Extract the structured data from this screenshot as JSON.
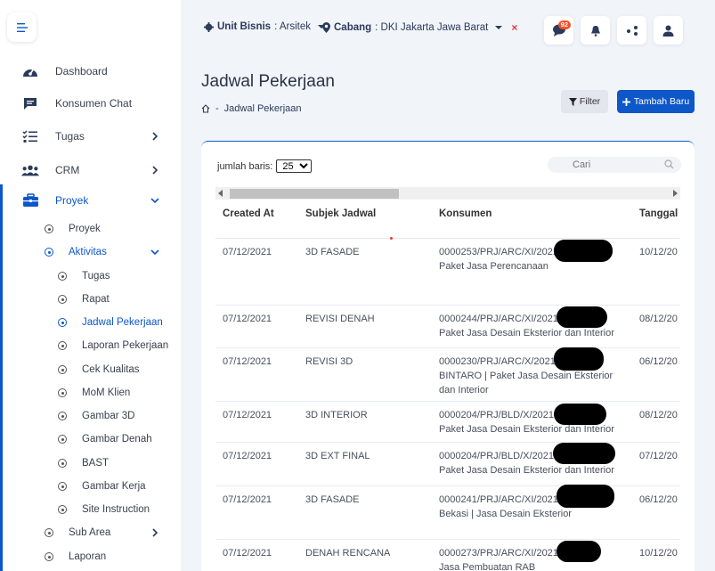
{
  "sidebar": {
    "nav": [
      {
        "label": "Dashboard",
        "icon": "dashboard-gauge-icon"
      },
      {
        "label": "Konsumen Chat",
        "icon": "chat-icon"
      },
      {
        "label": "Tugas",
        "icon": "checklist-icon"
      },
      {
        "label": "CRM",
        "icon": "users-icon"
      },
      {
        "label": "Proyek",
        "icon": "briefcase-icon"
      }
    ],
    "proyek_sub": [
      {
        "label": "Proyek"
      },
      {
        "label": "Aktivitas"
      }
    ],
    "aktivitas_sub": [
      {
        "label": "Tugas"
      },
      {
        "label": "Rapat"
      },
      {
        "label": "Jadwal Pekerjaan"
      },
      {
        "label": "Laporan Pekerjaan"
      },
      {
        "label": "Cek Kualitas"
      },
      {
        "label": "MoM Klien"
      },
      {
        "label": "Gambar 3D"
      },
      {
        "label": "Gambar Denah"
      },
      {
        "label": "BAST"
      },
      {
        "label": "Gambar Kerja"
      },
      {
        "label": "Site Instruction"
      }
    ],
    "bottom_sub": [
      {
        "label": "Sub Area"
      },
      {
        "label": "Laporan"
      }
    ]
  },
  "header": {
    "unit_label": "Unit Bisnis",
    "unit_value": ": Arsitek",
    "cabang_label": "Cabang",
    "cabang_value": ": DKI Jakarta Jawa Barat",
    "clear": "×",
    "notif_count": "92"
  },
  "page": {
    "title": "Jadwal Pekerjaan",
    "breadcrumb_sep": "-",
    "breadcrumb_current": "Jadwal Pekerjaan",
    "filter_label": "Filter",
    "add_label": "Tambah Baru"
  },
  "table": {
    "rows_label": "jumlah baris:",
    "rows_value": "25",
    "search_placeholder": "Cari",
    "columns": [
      "Created At",
      "Subjek Jadwal",
      "Konsumen",
      "Tanggal M"
    ],
    "rows": [
      {
        "created": "07/12/2021",
        "subject": "3D FASADE",
        "konsumen_1": "0000253/PRJ/ARC/XI/2021",
        "konsumen_2": "Paket Jasa Perencanaan",
        "tanggal": "10/12/20"
      },
      {
        "created": "07/12/2021",
        "subject": "REVISI DENAH",
        "konsumen_1": "0000244/PRJ/ARC/XI/2021",
        "konsumen_2": "Paket Jasa Desain Eksterior dan Interior",
        "tanggal": "08/12/20"
      },
      {
        "created": "07/12/2021",
        "subject": "REVISI 3D",
        "konsumen_1": "0000230/PRJ/ARC/X/2021",
        "konsumen_2": "BINTARO | Paket Jasa Desain Eksterior dan Interior",
        "tanggal": "06/12/20"
      },
      {
        "created": "07/12/2021",
        "subject": "3D INTERIOR",
        "konsumen_1": "0000204/PRJ/BLD/X/2021",
        "konsumen_2": "Paket Jasa Desain Eksterior dan Interior",
        "tanggal": "08/12/20"
      },
      {
        "created": "07/12/2021",
        "subject": "3D EXT FINAL",
        "konsumen_1": "0000204/PRJ/BLD/X/2021",
        "konsumen_2": "Paket Jasa Desain Eksterior dan Interior",
        "tanggal": "07/12/20"
      },
      {
        "created": "07/12/2021",
        "subject": "3D FASADE",
        "konsumen_1": "0000241/PRJ/ARC/XI/2021",
        "konsumen_2": "Bekasi | Jasa Desain Eksterior",
        "tanggal": "06/12/20"
      },
      {
        "created": "07/12/2021",
        "subject": "DENAH RENCANA",
        "konsumen_1": "0000273/PRJ/ARC/XI/2021",
        "konsumen_2": "Jasa Pembuatan RAB",
        "tanggal": "10/12/20"
      }
    ]
  },
  "colors": {
    "accent": "#0d57c9",
    "badge": "#f0512a",
    "clear": "#e5383b"
  }
}
